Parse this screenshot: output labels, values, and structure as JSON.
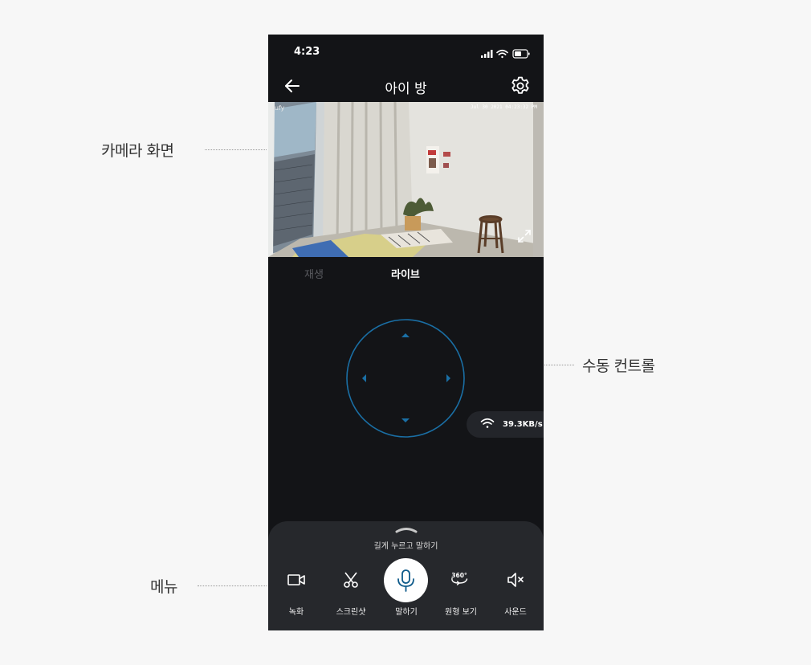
{
  "annotations": {
    "camera_view": "카메라 화면",
    "manual_control": "수동 컨트롤",
    "menu": "메뉴"
  },
  "status_bar": {
    "time": "4:23",
    "icons": [
      "signal-icon",
      "wifi-icon",
      "battery-icon"
    ]
  },
  "header": {
    "title": "아이 방",
    "back_icon": "arrow-left-icon",
    "settings_icon": "gear-icon"
  },
  "camera": {
    "logo": "eufy",
    "timestamp": "Jul 30 2021  04:23:32 PM"
  },
  "tabs": {
    "playback": "재생",
    "live": "라이브",
    "active": "live"
  },
  "network": {
    "speed": "39.3KB/s"
  },
  "menu": {
    "hint": "길게 누르고 말하기",
    "items": [
      {
        "label": "녹화",
        "icon": "video-camera-icon"
      },
      {
        "label": "스크린샷",
        "icon": "scissors-icon"
      },
      {
        "label": "말하기",
        "icon": "microphone-icon"
      },
      {
        "label": "원형 보기",
        "icon": "360-view-icon"
      },
      {
        "label": "사운드",
        "icon": "speaker-mute-icon"
      }
    ]
  },
  "colors": {
    "background": "#f7f7f7",
    "phone_bg": "#131417",
    "menu_bg": "#26282c",
    "accent_blue": "#1a6fa5",
    "mic_blue": "#0e5a8a"
  }
}
